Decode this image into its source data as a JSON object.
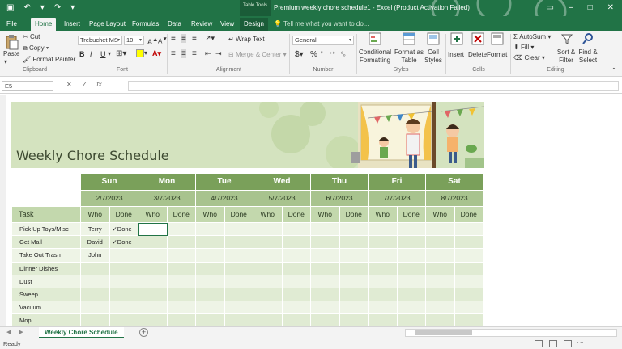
{
  "titlebar": {
    "context_tab": "Table Tools",
    "title": "Premium weekly chore schedule1 - Excel (Product Activation Failed)"
  },
  "tabs": [
    "File",
    "Home",
    "Insert",
    "Page Layout",
    "Formulas",
    "Data",
    "Review",
    "View",
    "Design"
  ],
  "active_tab": "Home",
  "tell_me": "Tell me what you want to do...",
  "ribbon": {
    "clipboard": {
      "paste": "Paste",
      "cut": "Cut",
      "copy": "Copy",
      "format_painter": "Format Painter",
      "label": "Clipboard"
    },
    "font": {
      "name": "Trebuchet MS",
      "size": "10",
      "label": "Font",
      "bold": "B",
      "italic": "I",
      "underline": "U"
    },
    "alignment": {
      "wrap": "Wrap Text",
      "merge": "Merge & Center",
      "label": "Alignment"
    },
    "number": {
      "format": "General",
      "label": "Number",
      "currency": "$",
      "percent": "%"
    },
    "styles": {
      "conditional": "Conditional Formatting",
      "format_table": "Format as Table",
      "cell_styles": "Cell Styles",
      "label": "Styles"
    },
    "cells": {
      "insert": "Insert",
      "delete": "Delete",
      "format": "Format",
      "label": "Cells"
    },
    "editing": {
      "autosum": "AutoSum",
      "fill": "Fill",
      "clear": "Clear",
      "sort": "Sort & Filter",
      "find": "Find & Select",
      "label": "Editing"
    }
  },
  "formula_bar": {
    "name_box": "E5",
    "fx": "fx"
  },
  "sheet": {
    "title": "Weekly Chore Schedule",
    "days": [
      {
        "day": "Sun",
        "date": "2/7/2023"
      },
      {
        "day": "Mon",
        "date": "3/7/2023"
      },
      {
        "day": "Tue",
        "date": "4/7/2023"
      },
      {
        "day": "Wed",
        "date": "5/7/2023"
      },
      {
        "day": "Thu",
        "date": "6/7/2023"
      },
      {
        "day": "Fri",
        "date": "7/7/2023"
      },
      {
        "day": "Sat",
        "date": "8/7/2023"
      }
    ],
    "task_header": "Task",
    "who_label": "Who",
    "done_label": "Done",
    "tasks": [
      {
        "task": "Pick Up Toys/Misc",
        "sun_who": "Terry",
        "sun_done": "✓Done"
      },
      {
        "task": "Get Mail",
        "sun_who": "David",
        "sun_done": "✓Done"
      },
      {
        "task": "Take Out Trash",
        "sun_who": "John",
        "sun_done": ""
      },
      {
        "task": "Dinner Dishes",
        "sun_who": "",
        "sun_done": ""
      },
      {
        "task": "Dust",
        "sun_who": "",
        "sun_done": ""
      },
      {
        "task": "Sweep",
        "sun_who": "",
        "sun_done": ""
      },
      {
        "task": "Vacuum",
        "sun_who": "",
        "sun_done": ""
      },
      {
        "task": "Mop",
        "sun_who": "",
        "sun_done": ""
      }
    ]
  },
  "sheet_tab": "Weekly Chore Schedule",
  "status": {
    "ready": "Ready",
    "zoom": "-  +"
  },
  "colors": {
    "excel_green": "#217346",
    "day_header": "#7aa05a",
    "date_row": "#a8c38e",
    "banner": "#d4e3bf"
  }
}
